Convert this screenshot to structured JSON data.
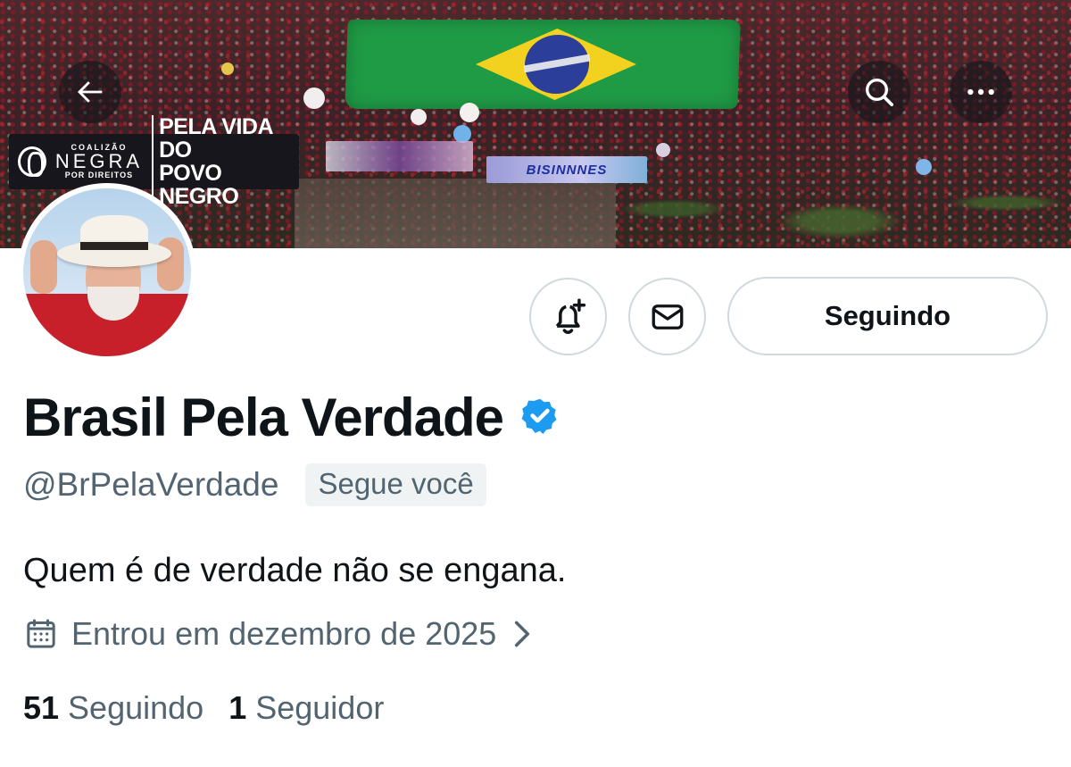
{
  "banner": {
    "sign_org_top": "COALIZÃO",
    "sign_org_main": "NEGRA",
    "sign_org_bottom": "POR DIREITOS",
    "sign_text_line1": "PELA VIDA DO",
    "sign_text_line2": "POVO NEGRO",
    "strip_text": "BISINNNES"
  },
  "actions": {
    "follow_label": "Seguindo"
  },
  "profile": {
    "display_name": "Brasil Pela Verdade",
    "handle": "@BrPelaVerdade",
    "follows_you": "Segue você",
    "bio": "Quem é de verdade não se engana.",
    "joined": "Entrou em dezembro de 2025"
  },
  "stats": {
    "following_count": "51",
    "following_label": "Seguindo",
    "followers_count": "1",
    "followers_label": "Seguidor"
  },
  "colors": {
    "verified": "#1d9bf0",
    "secondary_text": "#536471",
    "border": "#cfd9de"
  },
  "icons": [
    "back-arrow-icon",
    "search-icon",
    "more-icon",
    "notification-bell-plus-icon",
    "message-envelope-icon",
    "verified-badge-icon",
    "calendar-icon",
    "chevron-right-icon"
  ]
}
